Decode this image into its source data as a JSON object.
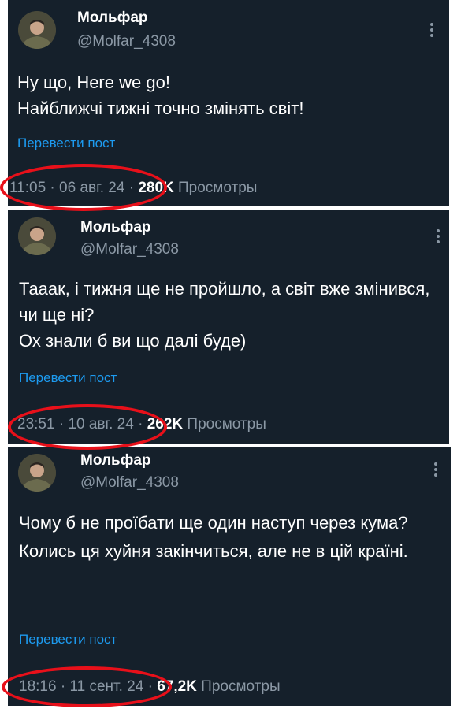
{
  "posts": [
    {
      "author_name": "Мольфар",
      "author_handle": "@Molfar_4308",
      "text": "Ну що, Here we go!\nНайближчі тижні точно змінять світ!",
      "translate_label": "Перевести пост",
      "time": "11:05",
      "date": "06 авг. 24",
      "views_count": "280K",
      "views_label": "Просмотры",
      "more_icon": "more-vertical-icon"
    },
    {
      "author_name": "Мольфар",
      "author_handle": "@Molfar_4308",
      "text": "Тааак, і тижня ще не пройшло, а світ вже змінився, чи ще ні?\nОх знали б ви що далі буде)",
      "translate_label": "Перевести пост",
      "time": "23:51",
      "date": "10 авг. 24",
      "views_count": "262K",
      "views_label": "Просмотры",
      "more_icon": "more-vertical-icon"
    },
    {
      "author_name": "Мольфар",
      "author_handle": "@Molfar_4308",
      "text": "Чому б не проїбати ще один наступ через кума?\nКолись ця хуйня закінчиться, але не в цій країні.",
      "translate_label": "Перевести пост",
      "time": "18:16",
      "date": "11 сент. 24",
      "views_count": "67,2K",
      "views_label": "Просмотры",
      "more_icon": "more-vertical-icon"
    }
  ],
  "colors": {
    "background": "#15202b",
    "text": "#ffffff",
    "secondary": "#8b98a5",
    "link": "#1d9bf0",
    "annotation": "#e8101a"
  }
}
